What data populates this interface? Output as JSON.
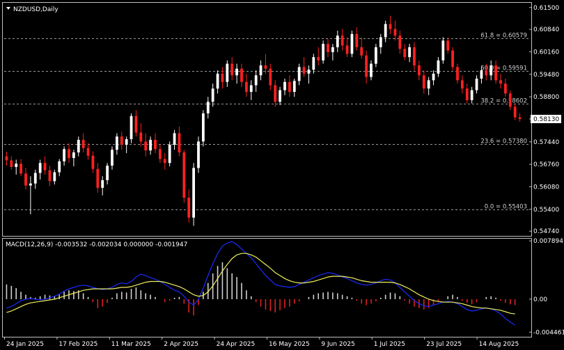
{
  "chart_title": "NZDUSD,Daily",
  "colors": {
    "background": "#000000",
    "bull_candle": "#ffffff",
    "bear_candle": "#ff2020",
    "fib_line": "#9a9a9a",
    "macd_line": "#1a2bff",
    "signal_line": "#f0f060",
    "hist_pos": "#d0d0d0",
    "hist_neg": "#e02020",
    "price_tag_bg": "#ffffff",
    "price_tag_text": "#000000",
    "frame": "#c0c0c0"
  },
  "chart_data": [
    {
      "type": "candlestick",
      "symbol": "NZDUSD",
      "timeframe": "Daily",
      "ylim": [
        0.5466,
        0.616
      ],
      "price_ticks": [
        "0.61500",
        "0.60840",
        "0.60160",
        "0.59480",
        "0.58800",
        "0.58130",
        "0.57440",
        "0.56760",
        "0.56080",
        "0.55400",
        "0.54740"
      ],
      "current_price": "0.58130",
      "x_ticks": [
        "24 Jan 2025",
        "17 Feb 2025",
        "11 Mar 2025",
        "2 Apr 2025",
        "24 Apr 2025",
        "16 May 2025",
        "9 Jun 2025",
        "1 Jul 2025",
        "23 Jul 2025",
        "14 Aug 2025"
      ],
      "fib_levels": [
        {
          "label": "61.8 = 0.60579",
          "price": 0.60579
        },
        {
          "label": "50.0 = 0.59591",
          "price": 0.59591
        },
        {
          "label": "38.2 = 0.58602",
          "price": 0.58602
        },
        {
          "label": "23.6 = 0.57380",
          "price": 0.5738
        },
        {
          "label": "0.0 = 0.55403",
          "price": 0.55403
        }
      ],
      "candles": [
        [
          0.57,
          0.5714,
          0.5672,
          0.5688
        ],
        [
          0.5688,
          0.57,
          0.566,
          0.5668
        ],
        [
          0.5668,
          0.569,
          0.5645,
          0.5678
        ],
        [
          0.5678,
          0.5692,
          0.564,
          0.5648
        ],
        [
          0.5648,
          0.5665,
          0.56,
          0.5612
        ],
        [
          0.5612,
          0.564,
          0.5525,
          0.5618
        ],
        [
          0.5618,
          0.566,
          0.5602,
          0.565
        ],
        [
          0.565,
          0.569,
          0.563,
          0.568
        ],
        [
          0.568,
          0.57,
          0.5645,
          0.5658
        ],
        [
          0.5658,
          0.5672,
          0.561,
          0.5625
        ],
        [
          0.5625,
          0.566,
          0.5615,
          0.5652
        ],
        [
          0.5652,
          0.5692,
          0.564,
          0.5685
        ],
        [
          0.5685,
          0.573,
          0.5672,
          0.5722
        ],
        [
          0.5722,
          0.574,
          0.568,
          0.5695
        ],
        [
          0.5695,
          0.572,
          0.567,
          0.5712
        ],
        [
          0.5712,
          0.576,
          0.57,
          0.575
        ],
        [
          0.575,
          0.577,
          0.5712,
          0.5725
        ],
        [
          0.5725,
          0.574,
          0.569,
          0.5702
        ],
        [
          0.5702,
          0.5715,
          0.565,
          0.5662
        ],
        [
          0.5662,
          0.568,
          0.559,
          0.5605
        ],
        [
          0.5605,
          0.564,
          0.5582,
          0.5628
        ],
        [
          0.5628,
          0.568,
          0.5615,
          0.5672
        ],
        [
          0.5672,
          0.573,
          0.566,
          0.572
        ],
        [
          0.572,
          0.577,
          0.5705,
          0.576
        ],
        [
          0.576,
          0.5775,
          0.572,
          0.5735
        ],
        [
          0.5735,
          0.576,
          0.571,
          0.5752
        ],
        [
          0.5752,
          0.583,
          0.574,
          0.5822
        ],
        [
          0.5822,
          0.584,
          0.576,
          0.5772
        ],
        [
          0.5772,
          0.58,
          0.573,
          0.5745
        ],
        [
          0.5745,
          0.577,
          0.57,
          0.5718
        ],
        [
          0.5718,
          0.576,
          0.5705,
          0.575
        ],
        [
          0.575,
          0.577,
          0.571,
          0.5722
        ],
        [
          0.5722,
          0.5735,
          0.568,
          0.5692
        ],
        [
          0.5692,
          0.571,
          0.566,
          0.568
        ],
        [
          0.568,
          0.5745,
          0.567,
          0.5735
        ],
        [
          0.5735,
          0.578,
          0.572,
          0.577
        ],
        [
          0.577,
          0.579,
          0.57,
          0.5712
        ],
        [
          0.5712,
          0.572,
          0.556,
          0.5575
        ],
        [
          0.5575,
          0.56,
          0.55,
          0.5515
        ],
        [
          0.5515,
          0.568,
          0.549,
          0.5665
        ],
        [
          0.5665,
          0.576,
          0.565,
          0.5745
        ],
        [
          0.5745,
          0.584,
          0.573,
          0.583
        ],
        [
          0.583,
          0.588,
          0.5815,
          0.5865
        ],
        [
          0.5865,
          0.592,
          0.585,
          0.5905
        ],
        [
          0.5905,
          0.596,
          0.589,
          0.595
        ],
        [
          0.595,
          0.597,
          0.5905,
          0.5925
        ],
        [
          0.5925,
          0.599,
          0.591,
          0.598
        ],
        [
          0.598,
          0.6,
          0.593,
          0.5945
        ],
        [
          0.5945,
          0.598,
          0.592,
          0.5965
        ],
        [
          0.5965,
          0.598,
          0.591,
          0.5925
        ],
        [
          0.5925,
          0.595,
          0.588,
          0.5895
        ],
        [
          0.5895,
          0.593,
          0.587,
          0.5915
        ],
        [
          0.5915,
          0.596,
          0.5895,
          0.5945
        ],
        [
          0.5945,
          0.599,
          0.593,
          0.5975
        ],
        [
          0.5975,
          0.601,
          0.595,
          0.5965
        ],
        [
          0.5965,
          0.598,
          0.59,
          0.5915
        ],
        [
          0.5915,
          0.593,
          0.585,
          0.5865
        ],
        [
          0.5865,
          0.591,
          0.5855,
          0.59
        ],
        [
          0.59,
          0.5935,
          0.5885,
          0.5925
        ],
        [
          0.5925,
          0.5945,
          0.588,
          0.5895
        ],
        [
          0.5895,
          0.5935,
          0.588,
          0.5928
        ],
        [
          0.5928,
          0.598,
          0.5915,
          0.597
        ],
        [
          0.597,
          0.6,
          0.594,
          0.595
        ],
        [
          0.595,
          0.5975,
          0.592,
          0.5962
        ],
        [
          0.5962,
          0.601,
          0.595,
          0.6
        ],
        [
          0.6,
          0.603,
          0.5975,
          0.599
        ],
        [
          0.599,
          0.605,
          0.598,
          0.604
        ],
        [
          0.604,
          0.6055,
          0.6,
          0.6015
        ],
        [
          0.6015,
          0.604,
          0.599,
          0.603
        ],
        [
          0.603,
          0.608,
          0.6015,
          0.6065
        ],
        [
          0.6065,
          0.6085,
          0.602,
          0.6035
        ],
        [
          0.6035,
          0.606,
          0.6,
          0.601
        ],
        [
          0.601,
          0.608,
          0.6,
          0.607
        ],
        [
          0.607,
          0.609,
          0.602,
          0.603
        ],
        [
          0.603,
          0.606,
          0.5995,
          0.6005
        ],
        [
          0.6005,
          0.602,
          0.592,
          0.594
        ],
        [
          0.594,
          0.599,
          0.593,
          0.598
        ],
        [
          0.598,
          0.604,
          0.597,
          0.603
        ],
        [
          0.603,
          0.607,
          0.601,
          0.606
        ],
        [
          0.606,
          0.611,
          0.6045,
          0.61
        ],
        [
          0.61,
          0.6125,
          0.607,
          0.6085
        ],
        [
          0.6085,
          0.611,
          0.605,
          0.6065
        ],
        [
          0.6065,
          0.608,
          0.601,
          0.6025
        ],
        [
          0.6025,
          0.604,
          0.599,
          0.6
        ],
        [
          0.6,
          0.604,
          0.5985,
          0.603
        ],
        [
          0.603,
          0.6045,
          0.596,
          0.5975
        ],
        [
          0.5975,
          0.599,
          0.593,
          0.5945
        ],
        [
          0.5945,
          0.596,
          0.589,
          0.5905
        ],
        [
          0.5905,
          0.594,
          0.5885,
          0.593
        ],
        [
          0.593,
          0.596,
          0.5915,
          0.595
        ],
        [
          0.595,
          0.6,
          0.594,
          0.599
        ],
        [
          0.599,
          0.606,
          0.598,
          0.605
        ],
        [
          0.605,
          0.606,
          0.601,
          0.602
        ],
        [
          0.602,
          0.603,
          0.596,
          0.597
        ],
        [
          0.597,
          0.598,
          0.592,
          0.593
        ],
        [
          0.593,
          0.5945,
          0.589,
          0.5905
        ],
        [
          0.5905,
          0.592,
          0.586,
          0.587
        ],
        [
          0.587,
          0.591,
          0.586,
          0.59
        ],
        [
          0.59,
          0.5945,
          0.589,
          0.5935
        ],
        [
          0.5935,
          0.597,
          0.592,
          0.596
        ],
        [
          0.596,
          0.598,
          0.593,
          0.5945
        ],
        [
          0.5945,
          0.599,
          0.593,
          0.5975
        ],
        [
          0.5975,
          0.599,
          0.592,
          0.593
        ],
        [
          0.593,
          0.595,
          0.5905,
          0.592
        ],
        [
          0.592,
          0.5935,
          0.588,
          0.589
        ],
        [
          0.589,
          0.59,
          0.584,
          0.585
        ],
        [
          0.585,
          0.586,
          0.581,
          0.5818
        ],
        [
          0.5818,
          0.583,
          0.5805,
          0.5813
        ]
      ]
    },
    {
      "type": "macd",
      "label": "MACD(12,26,9) -0.003532 -0.002034 0.000000 -0.001947",
      "ylim": [
        -0.0049,
        0.0081
      ],
      "y_ticks": [
        "0.007894",
        "0.00",
        "-0.004461"
      ],
      "histogram": [
        0.002,
        0.0018,
        0.0015,
        0.001,
        0.0006,
        0.0003,
        0.0002,
        0.0004,
        0.0006,
        0.0005,
        0.0004,
        0.0006,
        0.001,
        0.0012,
        0.0011,
        0.0012,
        0.0008,
        0.0003,
        -0.0004,
        -0.0012,
        -0.001,
        -0.0005,
        0.0002,
        0.0008,
        0.001,
        0.0009,
        0.0014,
        0.0016,
        0.0012,
        0.0008,
        0.0006,
        0.0003,
        0.0,
        -0.0004,
        -0.0002,
        0.0002,
        0.0003,
        -0.0006,
        -0.0018,
        -0.0022,
        -0.0008,
        0.001,
        0.0022,
        0.0035,
        0.0045,
        0.005,
        0.0042,
        0.0035,
        0.003,
        0.0022,
        0.0012,
        0.0004,
        -0.0004,
        -0.001,
        -0.0014,
        -0.0016,
        -0.0018,
        -0.0015,
        -0.0012,
        -0.001,
        -0.0006,
        -0.0003,
        0.0,
        0.0003,
        0.0006,
        0.0008,
        0.0009,
        0.001,
        0.0009,
        0.0008,
        0.0006,
        0.0004,
        0.0002,
        -0.0002,
        -0.0006,
        -0.0008,
        -0.0006,
        -0.0003,
        0.0002,
        0.0006,
        0.0009,
        0.0008,
        0.0004,
        -0.0002,
        -0.0006,
        -0.001,
        -0.0012,
        -0.0014,
        -0.0012,
        -0.0008,
        -0.0004,
        0.0,
        0.0004,
        0.0006,
        0.0003,
        -0.0002,
        -0.0005,
        -0.0007,
        -0.0004,
        0.0,
        0.0003,
        0.0004,
        0.0002,
        -0.0002,
        -0.0005,
        -0.0007,
        -0.0008
      ],
      "macd_line": [
        -0.0012,
        -0.001,
        -0.0006,
        -0.0002,
        0.0,
        0.0001,
        0.0,
        -0.0001,
        0.0,
        0.0002,
        0.0004,
        0.0007,
        0.0011,
        0.0014,
        0.0016,
        0.0018,
        0.0019,
        0.0018,
        0.0016,
        0.0014,
        0.0013,
        0.0014,
        0.0016,
        0.002,
        0.0022,
        0.0021,
        0.0024,
        0.003,
        0.0034,
        0.0032,
        0.0029,
        0.0027,
        0.0024,
        0.002,
        0.0016,
        0.0012,
        0.001,
        0.0004,
        -0.0004,
        -0.0008,
        0.0,
        0.0015,
        0.0032,
        0.0048,
        0.0062,
        0.0072,
        0.0076,
        0.0078,
        0.0074,
        0.0068,
        0.0062,
        0.0056,
        0.0048,
        0.004,
        0.0032,
        0.0026,
        0.002,
        0.0018,
        0.0017,
        0.0016,
        0.0017,
        0.002,
        0.0023,
        0.0026,
        0.0029,
        0.0032,
        0.0034,
        0.0036,
        0.0035,
        0.0033,
        0.003,
        0.0028,
        0.0025,
        0.0022,
        0.002,
        0.0019,
        0.002,
        0.0022,
        0.0025,
        0.0027,
        0.0026,
        0.0022,
        0.0016,
        0.001,
        0.0004,
        -0.0002,
        -0.0006,
        -0.0009,
        -0.001,
        -0.0008,
        -0.0006,
        -0.0004,
        -0.0003,
        -0.0004,
        -0.0006,
        -0.001,
        -0.0014,
        -0.0016,
        -0.0015,
        -0.0013,
        -0.0012,
        -0.0013,
        -0.0016,
        -0.002,
        -0.0026,
        -0.0031,
        -0.0035
      ],
      "signal_line": [
        -0.0018,
        -0.0016,
        -0.0013,
        -0.001,
        -0.0007,
        -0.0005,
        -0.0004,
        -0.0003,
        -0.0002,
        -0.0001,
        0.0,
        0.0002,
        0.0004,
        0.0006,
        0.0008,
        0.001,
        0.0012,
        0.0013,
        0.0014,
        0.0014,
        0.0014,
        0.0014,
        0.0014,
        0.0015,
        0.0016,
        0.0016,
        0.0017,
        0.0019,
        0.0021,
        0.0023,
        0.0024,
        0.0024,
        0.0024,
        0.0023,
        0.0021,
        0.0019,
        0.0017,
        0.0014,
        0.001,
        0.0006,
        0.0004,
        0.0005,
        0.001,
        0.0018,
        0.0028,
        0.0038,
        0.0047,
        0.0055,
        0.006,
        0.0062,
        0.0062,
        0.006,
        0.0057,
        0.0052,
        0.0047,
        0.0042,
        0.0036,
        0.0032,
        0.0028,
        0.0025,
        0.0023,
        0.0022,
        0.0022,
        0.0023,
        0.0024,
        0.0026,
        0.0028,
        0.003,
        0.0031,
        0.0031,
        0.0031,
        0.003,
        0.0029,
        0.0027,
        0.0025,
        0.0024,
        0.0023,
        0.0023,
        0.0023,
        0.0023,
        0.0023,
        0.0022,
        0.002,
        0.0017,
        0.0014,
        0.001,
        0.0006,
        0.0003,
        0.0,
        -0.0002,
        -0.0003,
        -0.0004,
        -0.0004,
        -0.0004,
        -0.0005,
        -0.0006,
        -0.0008,
        -0.001,
        -0.0011,
        -0.0012,
        -0.0012,
        -0.0013,
        -0.0014,
        -0.0015,
        -0.0017,
        -0.0019,
        -0.002
      ]
    }
  ]
}
